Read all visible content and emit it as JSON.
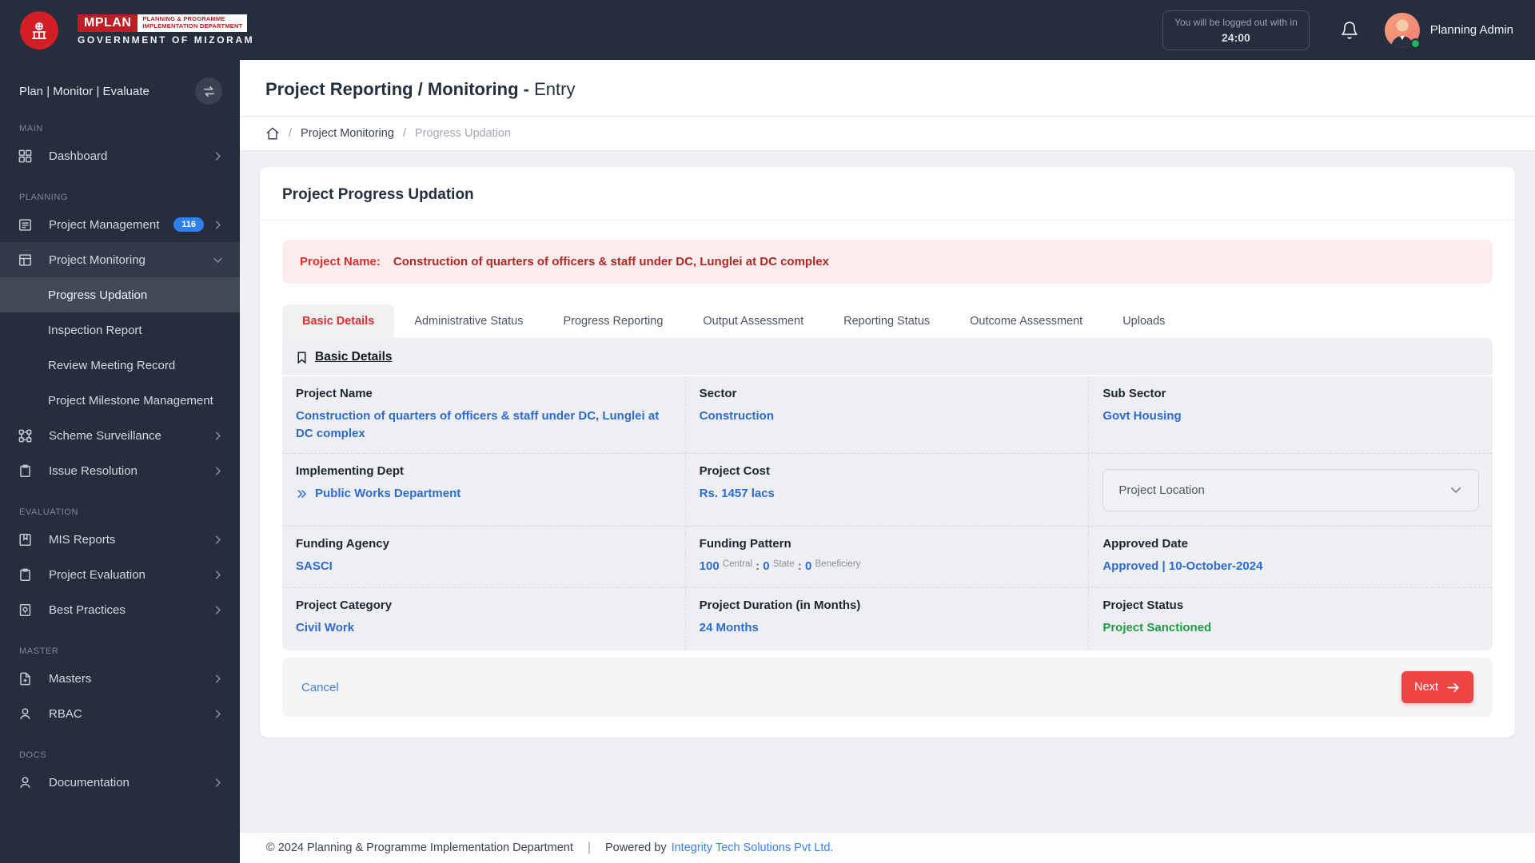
{
  "colors": {
    "topbar_dark": "#262d3d",
    "brand_red": "#c11c24",
    "alert_red_text": "#e12d2d",
    "value_blue": "#2e6bd0",
    "success_green": "#1f9d44",
    "badge_blue": "#2f80ed",
    "next_button_red": "#ef4444"
  },
  "topbar": {
    "brand": "MPLAN",
    "brand_sub1": "PLANNING & PROGRAMME",
    "brand_sub2": "IMPLEMENTATION DEPARTMENT",
    "brand_gov": "GOVERNMENT OF MIZORAM",
    "logout_notice": "You will be logged out with in",
    "logout_timer": "24:00",
    "user_name": "Planning Admin"
  },
  "sidebar": {
    "tagline": "Plan | Monitor | Evaluate",
    "section_main": "MAIN",
    "section_planning": "PLANNING",
    "section_evaluation": "EVALUATION",
    "section_master": "MASTER",
    "section_docs": "DOCS",
    "items": {
      "dashboard": "Dashboard",
      "project_management": "Project Management",
      "project_management_badge": "116",
      "project_monitoring": "Project Monitoring",
      "progress_updation": "Progress Updation",
      "inspection_report": "Inspection Report",
      "review_meeting_record": "Review Meeting Record",
      "project_milestone_management": "Project Milestone Management",
      "scheme_surveillance": "Scheme Surveillance",
      "issue_resolution": "Issue Resolution",
      "mis_reports": "MIS Reports",
      "project_evaluation": "Project Evaluation",
      "best_practices": "Best Practices",
      "masters": "Masters",
      "rbac": "RBAC",
      "documentation": "Documentation"
    }
  },
  "page": {
    "title": "Project Reporting / Monitoring -",
    "title_mode": "Entry",
    "breadcrumb_sep": "/",
    "breadcrumb_1": "Project Monitoring",
    "breadcrumb_2": "Progress Updation"
  },
  "card": {
    "title": "Project Progress Updation",
    "alert_label": "Project Name:",
    "alert_value": "Construction of quarters of officers & staff under DC, Lunglei at DC complex",
    "tabs": [
      "Basic Details",
      "Administrative Status",
      "Progress Reporting",
      "Output Assessment",
      "Reporting Status",
      "Outcome Assessment",
      "Uploads"
    ],
    "section_title": "Basic Details",
    "fields": {
      "project_name": {
        "label": "Project Name",
        "value": "Construction of quarters of officers & staff under DC, Lunglei at DC complex"
      },
      "sector": {
        "label": "Sector",
        "value": "Construction"
      },
      "sub_sector": {
        "label": "Sub Sector",
        "value": "Govt Housing"
      },
      "implementing_dept": {
        "label": "Implementing Dept",
        "value": "Public Works Department"
      },
      "project_cost": {
        "label": "Project Cost",
        "value": "Rs. 1457 lacs"
      },
      "project_location": {
        "placeholder": "Project Location"
      },
      "funding_agency": {
        "label": "Funding Agency",
        "value": "SASCI"
      },
      "funding_pattern": {
        "label": "Funding Pattern",
        "central_value": "100",
        "central_label": "Central",
        "sep": ":",
        "state_value": "0",
        "state_label": "State",
        "beneficiary_value": "0",
        "beneficiary_label": "Beneficiery"
      },
      "approved_date": {
        "label": "Approved Date",
        "value": "Approved | 10-October-2024"
      },
      "project_category": {
        "label": "Project Category",
        "value": "Civil Work"
      },
      "project_duration": {
        "label": "Project Duration (in Months)",
        "value": "24 Months"
      },
      "project_status": {
        "label": "Project Status",
        "value": "Project Sanctioned"
      }
    },
    "cancel_label": "Cancel",
    "next_label": "Next"
  },
  "footer": {
    "copyright": "© 2024 Planning & Programme Implementation Department",
    "divider": "|",
    "powered_by": "Powered by",
    "powered_by_link": "Integrity Tech Solutions Pvt Ltd."
  }
}
